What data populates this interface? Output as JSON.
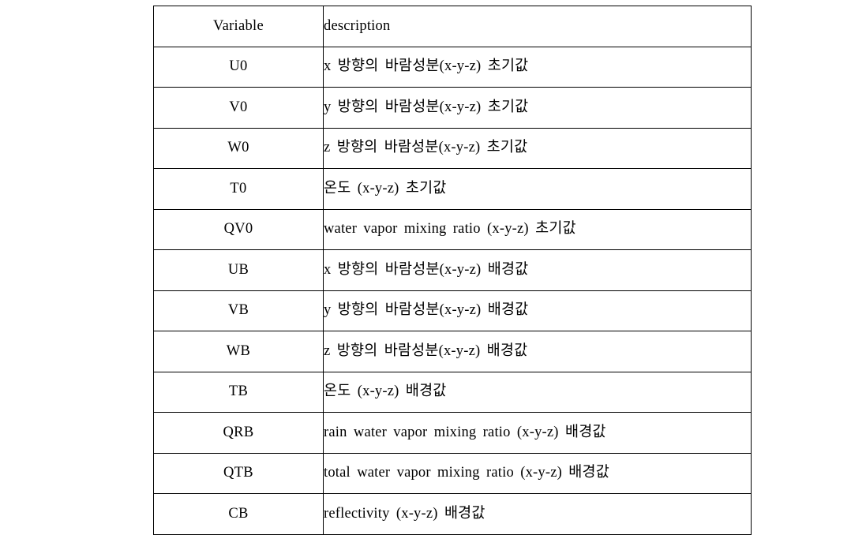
{
  "table": {
    "headers": {
      "variable": "Variable",
      "description": "description"
    },
    "rows": [
      {
        "variable": "U0",
        "description": "x 방향의 바람성분(x-y-z) 초기값"
      },
      {
        "variable": "V0",
        "description": "y 방향의 바람성분(x-y-z) 초기값"
      },
      {
        "variable": "W0",
        "description": "z 방향의 바람성분(x-y-z) 초기값"
      },
      {
        "variable": "T0",
        "description": "온도 (x-y-z) 초기값"
      },
      {
        "variable": "QV0",
        "description": "water vapor mixing ratio (x-y-z) 초기값"
      },
      {
        "variable": "UB",
        "description": "x 방향의 바람성분(x-y-z) 배경값"
      },
      {
        "variable": "VB",
        "description": "y 방향의 바람성분(x-y-z) 배경값"
      },
      {
        "variable": "WB",
        "description": "z 방향의 바람성분(x-y-z) 배경값"
      },
      {
        "variable": "TB",
        "description": "온도 (x-y-z) 배경값"
      },
      {
        "variable": "QRB",
        "description": "rain water vapor mixing ratio (x-y-z) 배경값"
      },
      {
        "variable": "QTB",
        "description": "total water vapor mixing ratio (x-y-z) 배경값"
      },
      {
        "variable": "CB",
        "description": "reflectivity (x-y-z) 배경값"
      }
    ]
  },
  "style": {
    "border_color": "#000000",
    "text_color": "#000000",
    "background_color": "#ffffff"
  }
}
